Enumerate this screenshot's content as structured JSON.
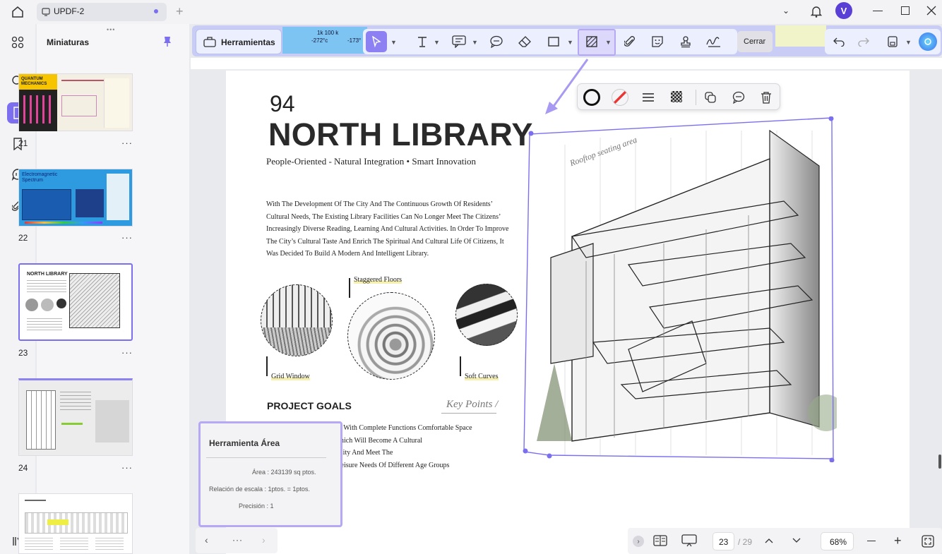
{
  "titlebar": {
    "tab_title": "UPDF-2",
    "avatar_letter": "V"
  },
  "sidebar": {
    "panel_title": "Miniaturas",
    "rail_icons": [
      "grid-icon",
      "search-icon",
      "pages-icon",
      "bookmark-icon",
      "comment-icon",
      "attachment-icon",
      "layers-icon"
    ],
    "thumbnails": [
      {
        "page": "21",
        "title": "QUANTUM MECHANICS",
        "more": "···"
      },
      {
        "page": "22",
        "title": "Electromagnetic Spectrum",
        "more": "···"
      },
      {
        "page": "23",
        "title": "NORTH LIBRARY",
        "more": "···"
      },
      {
        "page": "24",
        "title": "",
        "more": "···"
      },
      {
        "page": "",
        "title": "",
        "more": ""
      }
    ]
  },
  "toolbar": {
    "tools_label": "Herramientas",
    "close_label": "Cerrar",
    "ruler_top": "1k 100 k",
    "ruler_left": "-272°c",
    "ruler_right": "-173°"
  },
  "document": {
    "page_number": "94",
    "title": "NORTH LIBRARY",
    "subtitle": "People-Oriented - Natural Integration • Smart Innovation",
    "body": "With The Development Of The City And The Continuous Growth Of Residents’ Cultural Needs, The Existing Library Facilities Can No Longer Meet The Citizens’ Increasingly Diverse Reading, Learning And Cultural Activities. In Order To Improve The City’s Cultural Taste And Enrich The Spiritual And Cultural Life Of Citizens, It Was Decided To Build A Modern And Intelligent Library.",
    "captions": {
      "staggered": "Staggered Floors",
      "grid": "Grid Window",
      "soft": "Soft Curves"
    },
    "project_goals": "PROJECT GOALS",
    "key_points": "Key Points /",
    "goals_lines": [
      "Design A Library Building With Complete Functions Comfortable Space",
      "Promote Sustainability, Which Will Become A Cultural",
      "Exchange Center Of The City And Meet The",
      "Learning, Research And Leisure Needs Of Different Age Groups"
    ],
    "sketch_label": "Rooftop seating area"
  },
  "area_tool": {
    "title": "Herramienta Área",
    "area": "Área : 243139 sq ptos.",
    "scale": "Relación de escala : 1ptos. = 1ptos.",
    "precision": "Precisión : 1"
  },
  "bottombar": {
    "current_page": "23",
    "total_pages": "/ 29",
    "zoom": "68%",
    "more": "···"
  },
  "colors": {
    "accent": "#7b6ff0",
    "toolbar": "#c9ccf4",
    "selection": "#b6a8f4"
  }
}
